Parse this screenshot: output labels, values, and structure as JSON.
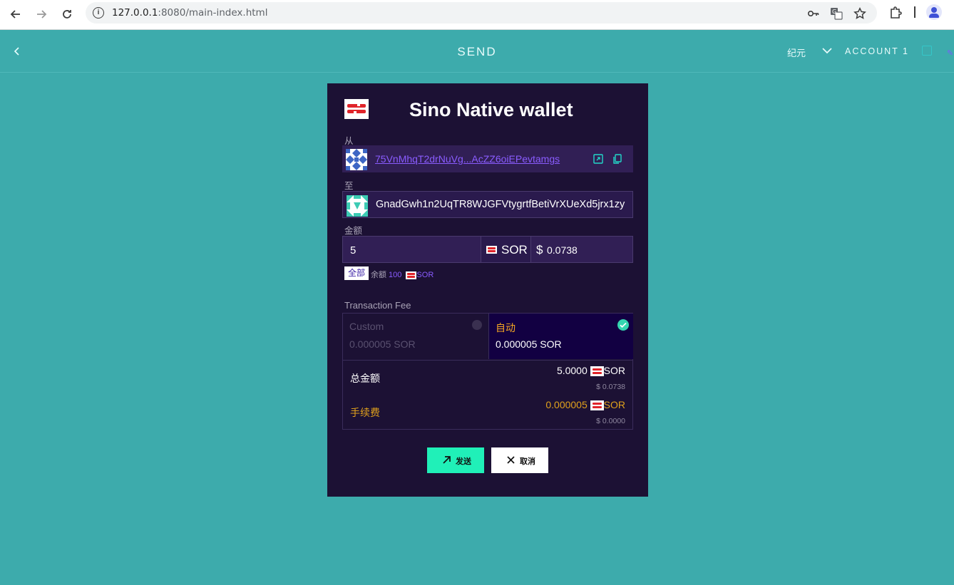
{
  "browser": {
    "url_host": "127.0.0.1",
    "url_rest": ":8080/main-index.html"
  },
  "header": {
    "title": "SEND",
    "language": "纪元",
    "account": "ACCOUNT 1"
  },
  "wallet": {
    "title": "Sino Native wallet",
    "from_label": "从",
    "from_address": "75VnMhqT2drNuVg...AcZZ6oiEPevtamgs",
    "to_label": "至",
    "to_address": "GnadGwh1n2UqTR8WJGFVtygrtfBetiVrXUeXd5jrx1zy",
    "amount_label": "金额",
    "amount_value": "5",
    "token": "SOR",
    "fiat_symbol": "$",
    "fiat_value": "0.0738",
    "all_button": "全部",
    "balance_label": "余额",
    "balance_value": "100",
    "balance_token": "SOR"
  },
  "fee": {
    "title": "Transaction Fee",
    "custom_label": "Custom",
    "custom_value": "0.000005 SOR",
    "auto_label": "自动",
    "auto_value": "0.000005 SOR",
    "selected": "auto"
  },
  "summary": {
    "total_label": "总金额",
    "total_value": "5.0000",
    "total_token": "SOR",
    "total_usd": "$ 0.0738",
    "fee_label": "手续费",
    "fee_value": "0.000005",
    "fee_token": "SOR",
    "fee_usd": "$ 0.0000"
  },
  "actions": {
    "send_label": "发送",
    "cancel_label": "取消"
  },
  "colors": {
    "background": "#3dabac",
    "card": "#1c1134",
    "accent": "#20f0b8",
    "link": "#8a5cff",
    "fee_highlight": "#e0a11c"
  }
}
